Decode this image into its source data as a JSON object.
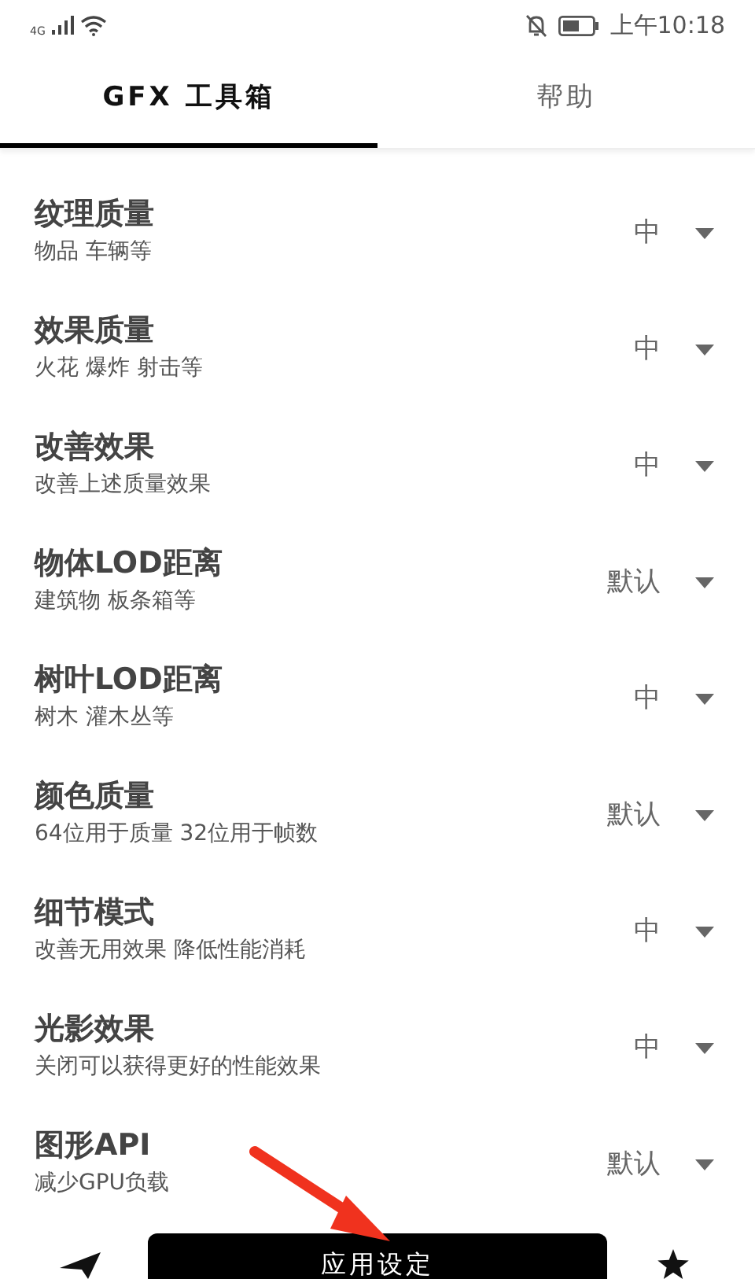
{
  "status_bar": {
    "network": "4G",
    "time": "上午10:18"
  },
  "tabs": [
    {
      "label": "GFX 工具箱",
      "selected": true
    },
    {
      "label": "帮助",
      "selected": false
    }
  ],
  "settings": [
    {
      "title": "纹理质量",
      "subtitle": "物品 车辆等",
      "value": "中"
    },
    {
      "title": "效果质量",
      "subtitle": "火花 爆炸 射击等",
      "value": "中"
    },
    {
      "title": "改善效果",
      "subtitle": "改善上述质量效果",
      "value": "中"
    },
    {
      "title": "物体LOD距离",
      "subtitle": "建筑物 板条箱等",
      "value": "默认"
    },
    {
      "title": "树叶LOD距离",
      "subtitle": "树木 灌木丛等",
      "value": "中"
    },
    {
      "title": "颜色质量",
      "subtitle": "64位用于质量 32位用于帧数",
      "value": "默认"
    },
    {
      "title": "细节模式",
      "subtitle": "改善无用效果 降低性能消耗",
      "value": "中"
    },
    {
      "title": "光影效果",
      "subtitle": "关闭可以获得更好的性能效果",
      "value": "中"
    },
    {
      "title": "图形API",
      "subtitle": "减少GPU负载",
      "value": "默认"
    }
  ],
  "apply_button": {
    "label": "应用设定"
  }
}
